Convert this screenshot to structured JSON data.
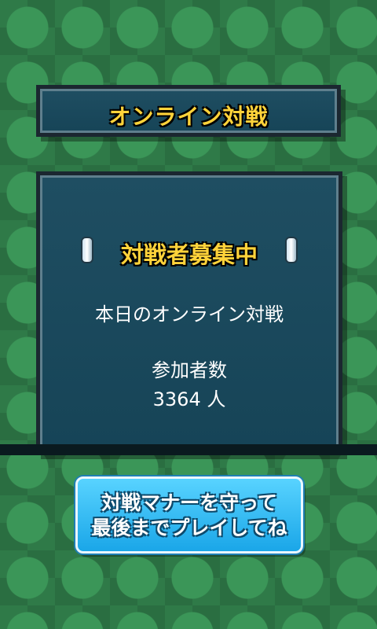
{
  "title": "オンライン対戦",
  "panel": {
    "header": "対戦者募集中",
    "line1": "本日のオンライン対戦",
    "line2": "参加者数",
    "line3": "3364 人"
  },
  "cta": {
    "line1": "対戦マナーを守って",
    "line2": "最後までプレイしてね"
  },
  "colors": {
    "background": "#2f7a48",
    "panel": "#1f4e62",
    "title_text": "#ffd33a",
    "cta": "#1aa6e8"
  }
}
